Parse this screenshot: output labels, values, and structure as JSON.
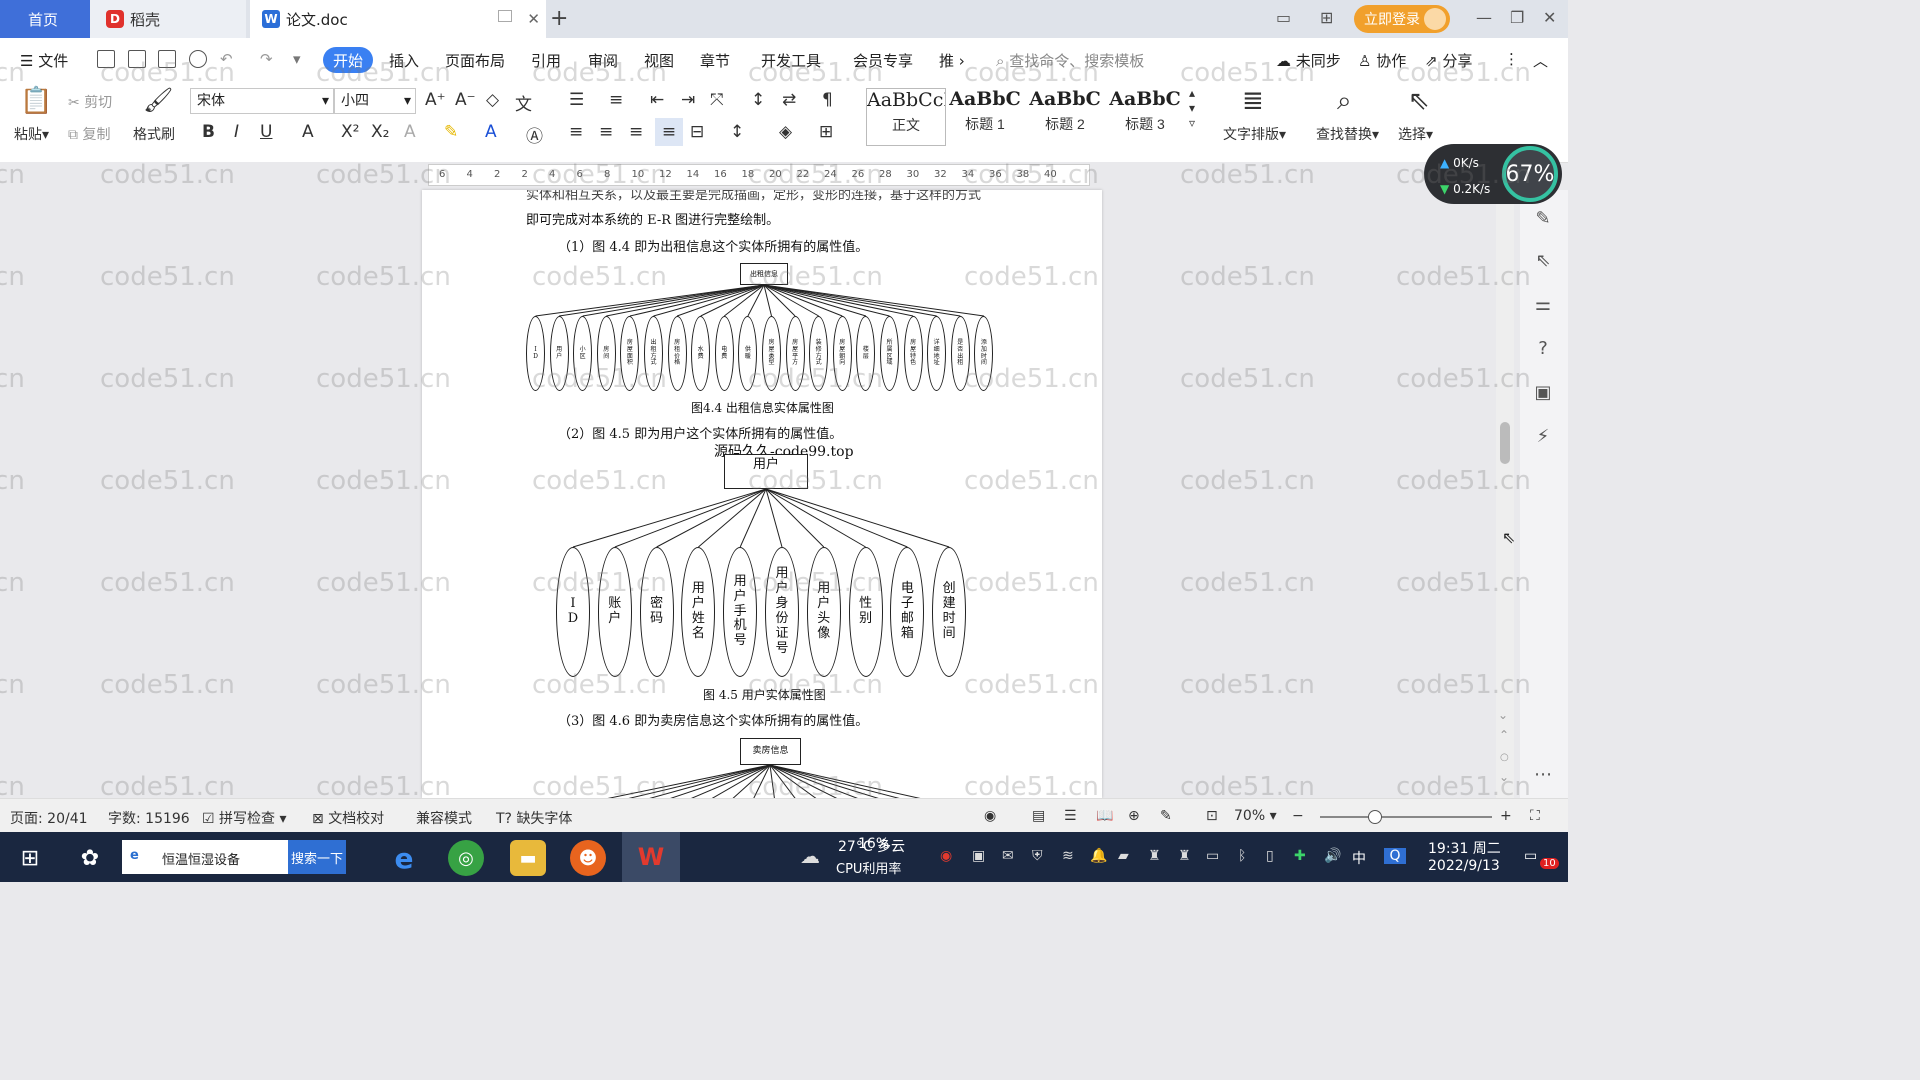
{
  "tabs": {
    "home": "首页",
    "docer": "稻壳",
    "doc": "论文.doc"
  },
  "login": "立即登录",
  "menu": {
    "file": "文件",
    "items": [
      "开始",
      "插入",
      "页面布局",
      "引用",
      "审阅",
      "视图",
      "章节",
      "开发工具",
      "会员专享",
      "推"
    ],
    "search_cmd": "查找命令、搜索模板",
    "sync": "未同步",
    "collab": "协作",
    "share": "分享"
  },
  "ribbon": {
    "paste": "粘贴",
    "cut": "剪切",
    "copy": "复制",
    "format_painter": "格式刷",
    "font": "宋体",
    "size": "小四",
    "styles": [
      {
        "sample": "AaBbCcI",
        "name": "正文"
      },
      {
        "sample": "AaBbC",
        "name": "标题 1"
      },
      {
        "sample": "AaBbC",
        "name": "标题 2"
      },
      {
        "sample": "AaBbC",
        "name": "标题 3"
      }
    ],
    "text_layout": "文字排版",
    "find_replace": "查找替换",
    "select": "选择"
  },
  "ruler_ticks": [
    "6",
    "4",
    "2",
    "2",
    "4",
    "6",
    "8",
    "10",
    "12",
    "14",
    "16",
    "18",
    "20",
    "22",
    "24",
    "26",
    "28",
    "30",
    "32",
    "34",
    "36",
    "38",
    "40"
  ],
  "net": {
    "up": "0K/s",
    "down": "0.2K/s",
    "percent": "67%"
  },
  "document": {
    "line_top_cut": "实体和相互关系，以及最主要是完成描画，定形，变形的连接，基于这样的方式",
    "line1": "即可完成对本系统的 E-R 图进行完整绘制。",
    "p1": "（1）图 4.4 即为出租信息这个实体所拥有的属性值。",
    "fig44_entity": "出租信息",
    "fig44_attrs": [
      "ID",
      "用户",
      "小区",
      "房间",
      "房屋面积",
      "出租方式",
      "房租价格",
      "水费",
      "电费",
      "供暖",
      "房屋类型",
      "房屋平方",
      "装修方式",
      "房屋朝向",
      "楼层",
      "所属区域",
      "房屋特色",
      "详细地址",
      "是否出租",
      "添加时间"
    ],
    "fig44_caption": "图4.4 出租信息实体属性图",
    "p2": "（2）图 4.5 即为用户这个实体所拥有的属性值。",
    "watermark_line": "源码久久-code99.top",
    "fig45_entity": "用户",
    "fig45_attrs": [
      "ID",
      "账户",
      "密码",
      "用户姓名",
      "用户手机号",
      "用户身份证号",
      "用户头像",
      "性别",
      "电子邮箱",
      "创建时间"
    ],
    "fig45_caption": "图 4.5  用户实体属性图",
    "p3": "（3）图 4.6 即为卖房信息这个实体所拥有的属性值。",
    "fig46_entity": "卖房信息"
  },
  "watermark": "code51.cn",
  "status": {
    "page": "页面: 20/41",
    "words": "字数: 15196",
    "spell": "拼写检查",
    "proof": "文档校对",
    "compat": "兼容模式",
    "missing_font": "缺失字体",
    "zoom": "70%"
  },
  "taskbar": {
    "search_text": "恒温恒湿设备",
    "search_btn": "搜索一下",
    "weather": "27°C 多云",
    "cpu_pct": "16%",
    "cpu_label": "CPU利用率",
    "ime": "中",
    "time": "19:31 周二",
    "date": "2022/9/13",
    "notif": "10"
  }
}
